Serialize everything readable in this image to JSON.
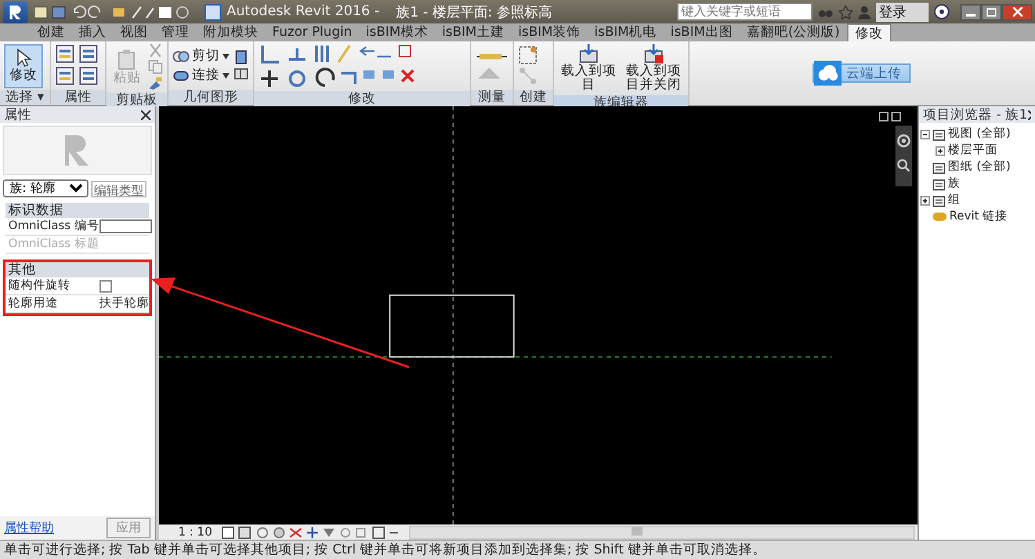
{
  "window": {
    "app_title": "Autodesk Revit 2016 -",
    "document_title": "族1 - 楼层平面: 参照标高"
  },
  "search": {
    "placeholder": "键入关键字或短语"
  },
  "user": {
    "label": "登录"
  },
  "ribbon": {
    "tabs": [
      {
        "label": "创建",
        "selected": false
      },
      {
        "label": "插入",
        "selected": false
      },
      {
        "label": "视图",
        "selected": false
      },
      {
        "label": "管理",
        "selected": false
      },
      {
        "label": "附加模块",
        "selected": false
      },
      {
        "label": "Fuzor Plugin",
        "selected": false
      },
      {
        "label": "isBIM模术",
        "selected": false
      },
      {
        "label": "isBIM土建",
        "selected": false
      },
      {
        "label": "isBIM装饰",
        "selected": false
      },
      {
        "label": "isBIM机电",
        "selected": false
      },
      {
        "label": "isBIM出图",
        "selected": false
      },
      {
        "label": "嘉翻吧(公测版)",
        "selected": false
      },
      {
        "label": "修改",
        "selected": true
      }
    ],
    "panels": [
      {
        "kind": "select",
        "title": "选择 ▾",
        "buttons": [
          "修改"
        ]
      },
      {
        "kind": "properties",
        "title": "属性"
      },
      {
        "kind": "clipboard",
        "title": "剪贴板",
        "buttons": [
          "粘贴"
        ]
      },
      {
        "kind": "geometry",
        "title": "几何图形",
        "buttons": [
          "剪切",
          "连接"
        ]
      },
      {
        "kind": "modify",
        "title": "修改"
      },
      {
        "kind": "measure",
        "title": "测量"
      },
      {
        "kind": "create",
        "title": "创建"
      },
      {
        "kind": "family",
        "title": "族编辑器",
        "buttons": [
          "载入到项目",
          "载入到项目并关闭"
        ]
      }
    ],
    "cloud_button": "云端上传"
  },
  "properties": {
    "title": "属性",
    "type_selector": "族: 轮廓",
    "edit_type": "编辑类型",
    "sections": [
      {
        "title": "标识数据",
        "highlighted": false,
        "rows": [
          {
            "label": "OmniClass 编号",
            "kind": "text",
            "value": "",
            "disabled": false
          },
          {
            "label": "OmniClass 标题",
            "kind": "text",
            "value": "",
            "disabled": true
          }
        ]
      },
      {
        "title": "其他",
        "highlighted": true,
        "rows": [
          {
            "label": "随构件旋转",
            "kind": "checkbox",
            "checked": false,
            "disabled": false
          },
          {
            "label": "轮廓用途",
            "kind": "text",
            "value": "扶手轮廓",
            "disabled": false
          }
        ]
      }
    ],
    "help_link": "属性帮助",
    "apply_button": "应用"
  },
  "browser": {
    "title": "项目浏览器 - 族1",
    "tree": [
      {
        "label": "视图 (全部)",
        "kind": "group",
        "expanded": true,
        "children": [
          {
            "label": "楼层平面",
            "kind": "group",
            "expanded": false
          }
        ]
      },
      {
        "label": "图纸 (全部)",
        "kind": "item"
      },
      {
        "label": "族",
        "kind": "item"
      },
      {
        "label": "组",
        "kind": "group",
        "expanded": false
      },
      {
        "label": "Revit 链接",
        "kind": "link"
      }
    ]
  },
  "view_bar": {
    "scale": "1 : 10"
  },
  "status_bar": {
    "text": "单击可进行选择; 按 Tab 键并单击可选择其他项目; 按 Ctrl 键并单击可将新项目添加到选择集; 按 Shift 键并单击可取消选择。"
  }
}
